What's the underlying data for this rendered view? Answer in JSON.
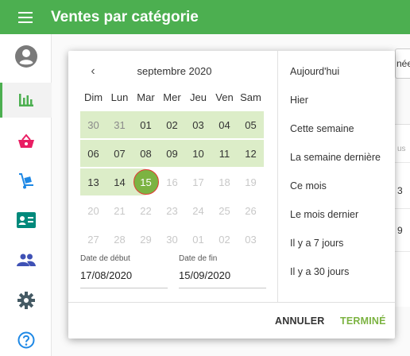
{
  "app": {
    "title": "Ventes par catégorie"
  },
  "header": {
    "menu_icon": "hamburger-icon"
  },
  "sidebar": {
    "items": [
      {
        "name": "account",
        "icon": "account-icon",
        "color": "#7a7a7a"
      },
      {
        "name": "sales",
        "icon": "bar-chart-icon",
        "color": "#4caf50",
        "active": true
      },
      {
        "name": "basket",
        "icon": "basket-icon",
        "color": "#e91e63"
      },
      {
        "name": "delivery",
        "icon": "hand-truck-icon",
        "color": "#1e88e5"
      },
      {
        "name": "customers",
        "icon": "id-card-icon",
        "color": "#00897b"
      },
      {
        "name": "users",
        "icon": "people-icon",
        "color": "#3f51b5"
      },
      {
        "name": "settings",
        "icon": "gear-icon",
        "color": "#455a64"
      },
      {
        "name": "help",
        "icon": "help-icon",
        "color": "#1e88e5"
      }
    ]
  },
  "background": {
    "strip_text": "née",
    "cells": [
      "us",
      "3",
      "9"
    ]
  },
  "calendar": {
    "month_label": "septembre 2020",
    "weekdays": [
      "Dim",
      "Lun",
      "Mar",
      "Mer",
      "Jeu",
      "Ven",
      "Sam"
    ],
    "weeks": [
      [
        {
          "d": "30",
          "s": "other-range"
        },
        {
          "d": "31",
          "s": "other-range"
        },
        {
          "d": "01",
          "s": "range"
        },
        {
          "d": "02",
          "s": "range"
        },
        {
          "d": "03",
          "s": "range"
        },
        {
          "d": "04",
          "s": "range"
        },
        {
          "d": "05",
          "s": "range"
        }
      ],
      [
        {
          "d": "06",
          "s": "range"
        },
        {
          "d": "07",
          "s": "range"
        },
        {
          "d": "08",
          "s": "range"
        },
        {
          "d": "09",
          "s": "range"
        },
        {
          "d": "10",
          "s": "range"
        },
        {
          "d": "11",
          "s": "range"
        },
        {
          "d": "12",
          "s": "range"
        }
      ],
      [
        {
          "d": "13",
          "s": "range"
        },
        {
          "d": "14",
          "s": "range"
        },
        {
          "d": "15",
          "s": "selected"
        },
        {
          "d": "16",
          "s": "disabled"
        },
        {
          "d": "17",
          "s": "disabled"
        },
        {
          "d": "18",
          "s": "disabled"
        },
        {
          "d": "19",
          "s": "disabled"
        }
      ],
      [
        {
          "d": "20",
          "s": "disabled"
        },
        {
          "d": "21",
          "s": "disabled"
        },
        {
          "d": "22",
          "s": "disabled"
        },
        {
          "d": "23",
          "s": "disabled"
        },
        {
          "d": "24",
          "s": "disabled"
        },
        {
          "d": "25",
          "s": "disabled"
        },
        {
          "d": "26",
          "s": "disabled"
        }
      ],
      [
        {
          "d": "27",
          "s": "disabled"
        },
        {
          "d": "28",
          "s": "disabled"
        },
        {
          "d": "29",
          "s": "disabled"
        },
        {
          "d": "30",
          "s": "disabled"
        },
        {
          "d": "01",
          "s": "disabled"
        },
        {
          "d": "02",
          "s": "disabled"
        },
        {
          "d": "03",
          "s": "disabled"
        }
      ]
    ],
    "start_label": "Date de début",
    "start_value": "17/08/2020",
    "end_label": "Date de fin",
    "end_value": "15/09/2020"
  },
  "presets": [
    "Aujourd'hui",
    "Hier",
    "Cette semaine",
    "La semaine dernière",
    "Ce mois",
    "Le mois dernier",
    "Il y a 7 jours",
    "Il y a 30 jours"
  ],
  "actions": {
    "cancel": "ANNULER",
    "done": "TERMINÉ"
  },
  "colors": {
    "primary": "#4caf50",
    "range": "#dcedc8",
    "selected": "#7cb342",
    "done": "#7cb342"
  }
}
